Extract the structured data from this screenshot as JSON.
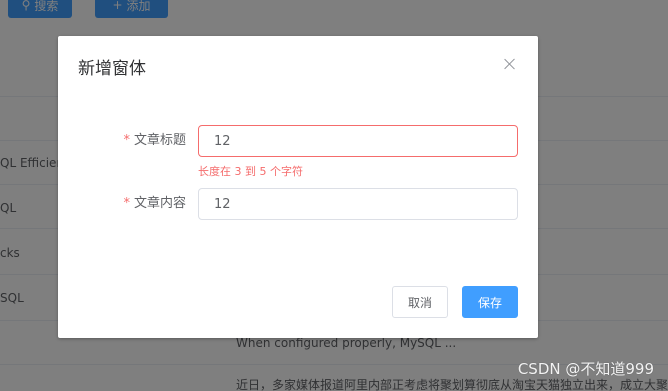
{
  "toolbar": {
    "search_label": "搜索",
    "add_label": "添加"
  },
  "table": {
    "cells": [
      "QL Efficien",
      "QL",
      "cks",
      "SQL"
    ]
  },
  "background_snippets": {
    "content_1": "When configured properly, MySQL ...",
    "content_2": "近日，多家媒体报道阿里内部正考虑将聚划算彻底从淘宝天猫独立出来，成立大聚"
  },
  "dialog": {
    "title": "新增窗体",
    "fields": [
      {
        "label": "文章标题",
        "required_mark": "*",
        "value": "12",
        "error": "长度在 3 到 5 个字符"
      },
      {
        "label": "文章内容",
        "required_mark": "*",
        "value": "12"
      }
    ],
    "cancel_label": "取消",
    "save_label": "保存"
  },
  "watermark": "CSDN @不知道999"
}
